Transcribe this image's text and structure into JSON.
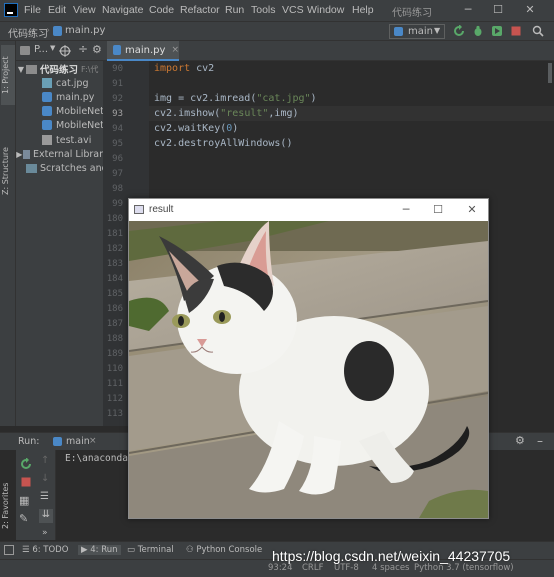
{
  "menubar": {
    "items": [
      "File",
      "Edit",
      "View",
      "Navigate",
      "Code",
      "Refactor",
      "Run",
      "Tools",
      "VCS",
      "Window",
      "Help"
    ],
    "window_title": "代码练习"
  },
  "navbar": {
    "crumb_project": "代码练习",
    "crumb_file": "main.py",
    "run_config": "main"
  },
  "project_panel": {
    "header": "P...",
    "tree": [
      {
        "label": "代码练习",
        "suffix": "F:\\代",
        "kind": "folder"
      },
      {
        "label": "cat.jpg",
        "kind": "image"
      },
      {
        "label": "main.py",
        "kind": "python"
      },
      {
        "label": "MobileNet",
        "kind": "python"
      },
      {
        "label": "MobileNet",
        "kind": "python"
      },
      {
        "label": "test.avi",
        "kind": "file"
      },
      {
        "label": "External Librar",
        "kind": "library"
      },
      {
        "label": "Scratches and",
        "kind": "scratch"
      }
    ]
  },
  "left_tabs": {
    "project": "1: Project",
    "structure": "Z: Structure",
    "favorites": "2: Favorites"
  },
  "editor": {
    "tab_label": "main.py",
    "line_numbers": [
      "90",
      "91",
      "92",
      "93",
      "94",
      "95",
      "96",
      "97",
      "98",
      "99",
      "180",
      "181",
      "182",
      "183",
      "184",
      "185",
      "186",
      "187",
      "188",
      "189",
      "110",
      "111",
      "112",
      "113"
    ],
    "code": {
      "l1_kw": "import",
      "l1_rest": " cv2",
      "l2": "",
      "l3_a": "img = cv2.imread(",
      "l3_str": "\"cat.jpg\"",
      "l3_b": ")",
      "l4_a": "cv2.imshow(",
      "l4_str": "\"result\"",
      "l4_b": ",img)",
      "l5_a": "cv2.waitKey(",
      "l5_num": "0",
      "l5_b": ")",
      "l6": "cv2.destroyAllWindows()"
    }
  },
  "run_panel": {
    "label": "Run:",
    "config": "main",
    "output": "E:\\anaconda"
  },
  "bottom_tabs": [
    "6: TODO",
    "4: Run",
    "Terminal",
    "Python Console"
  ],
  "status": {
    "position": "93:24",
    "line_sep": "CRLF",
    "encoding": "UTF-8",
    "indent": "4 spaces",
    "interpreter": "Python 3.7 (tensorflow)"
  },
  "result_window": {
    "title": "result"
  },
  "watermark": "https://blog.csdn.net/weixin_44237705",
  "colors": {
    "bg_editor": "#2b2b2b",
    "bg_panel": "#3c3f41",
    "keyword": "#cc7832",
    "string": "#6a8759",
    "number": "#6897bb"
  }
}
